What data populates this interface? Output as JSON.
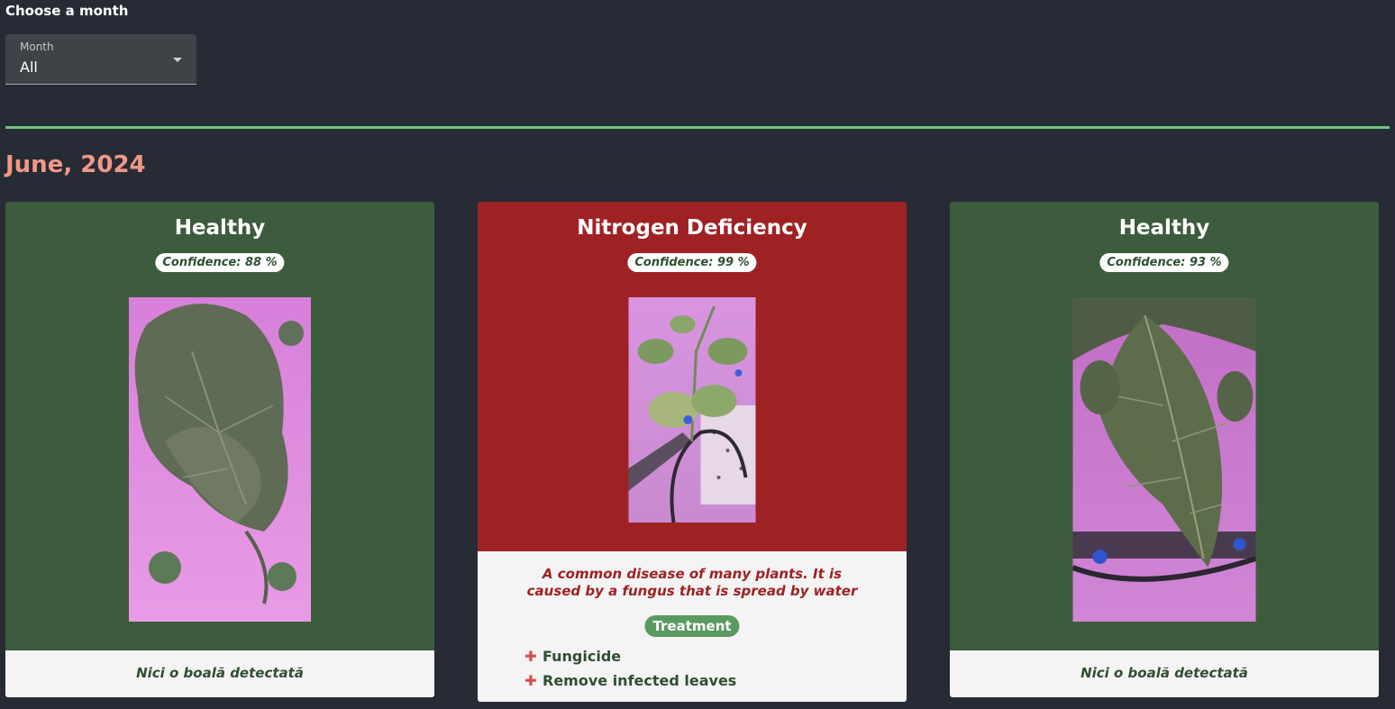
{
  "filter": {
    "heading": "Choose a month",
    "caption": "Month",
    "selected": "All"
  },
  "section": {
    "title": "June, 2024"
  },
  "cards": [
    {
      "status": "Healthy",
      "confidence": "Confidence: 88 %",
      "footer": "Nici o boală detectată",
      "photo_icon": "tomato-leaf-photo"
    },
    {
      "status": "Nitrogen Deficiency",
      "confidence": "Confidence: 99 %",
      "description": "A common disease of many plants. It is caused by a fungus that is spread by water",
      "treatment_label": "Treatment",
      "treatments": [
        "Fungicide",
        "Remove infected leaves"
      ],
      "photo_icon": "tomato-seedling-photo"
    },
    {
      "status": "Healthy",
      "confidence": "Confidence: 93 %",
      "footer": "Nici o boală detectată",
      "photo_icon": "tomato-leaf-photo"
    }
  ],
  "colors": {
    "background": "#262b35",
    "divider": "#6fc47e",
    "month_title": "#f19887",
    "healthy_card": "#3d5c3e",
    "disease_card": "#9e2224",
    "treatment_badge": "#5a9a60"
  }
}
